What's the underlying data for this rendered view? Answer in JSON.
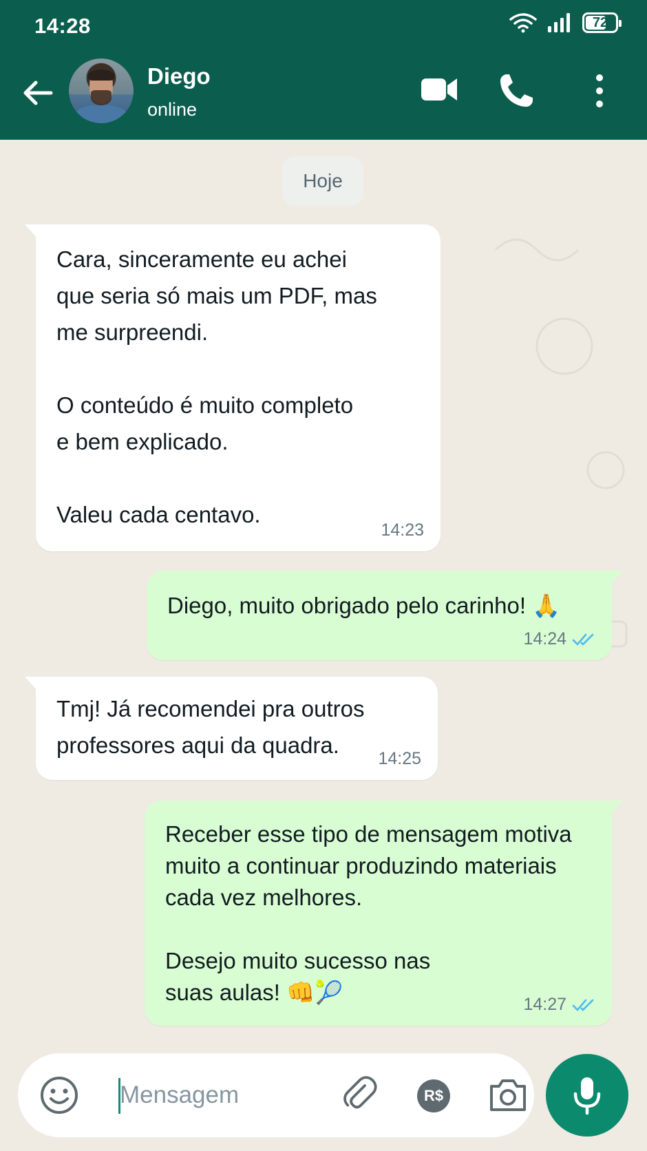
{
  "status_bar": {
    "time": "14:28",
    "battery": "72",
    "battery_level": 0.72
  },
  "header": {
    "contact_name": "Diego",
    "contact_status": "online"
  },
  "date_separator": "Hoje",
  "messages": [
    {
      "direction": "incoming",
      "text": "Cara, sinceramente eu achei\nque seria só mais um PDF, mas\nme surpreendi.\n\nO conteúdo é muito completo\ne bem explicado.\n\nValeu cada centavo.",
      "time": "14:23"
    },
    {
      "direction": "outgoing",
      "text": "Diego, muito obrigado pelo carinho! 🙏",
      "time": "14:24",
      "status": "read"
    },
    {
      "direction": "incoming",
      "text": "Tmj! Já recomendei pra outros\nprofessores aqui da quadra.",
      "time": "14:25"
    },
    {
      "direction": "outgoing",
      "text": "Receber esse tipo de mensagem motiva\nmuito a continuar produzindo materiais\ncada vez melhores.\n\nDesejo muito sucesso nas\nsuas aulas! 👊🎾",
      "time": "14:27",
      "status": "read"
    }
  ],
  "composer": {
    "placeholder": "Mensagem",
    "value": "",
    "pay_label": "R$"
  },
  "colors": {
    "header": "#0b5d4e",
    "outgoing_bubble": "#d9fdd3",
    "incoming_bubble": "#ffffff",
    "read_ticks": "#53bdeb",
    "mic_button": "#0b8a6e",
    "chat_background": "#efeae2"
  }
}
